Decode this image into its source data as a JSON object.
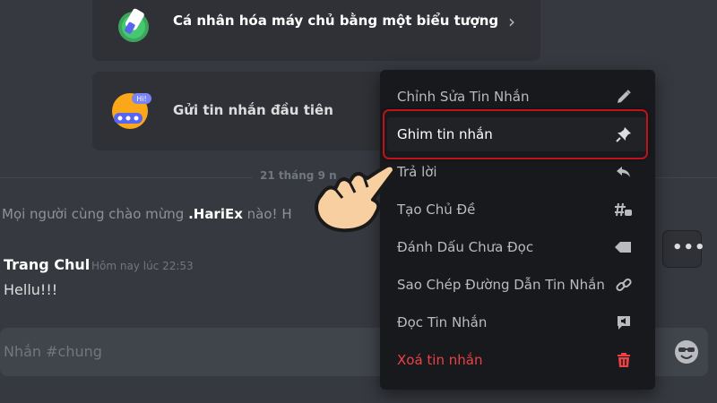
{
  "cards": {
    "customize_label": "Cá nhân hóa máy chủ bằng một biểu tượng",
    "first_message_label": "Gửi tin nhắn đầu tiên",
    "chevron": "›",
    "bubble_text": "Hi!"
  },
  "chat": {
    "date_divider": "21 tháng 9 n",
    "system_message": {
      "prefix": "Mọi người cùng chào mừng ",
      "username": ".HariEx",
      "suffix": " nào! H"
    },
    "message": {
      "author": "Trang Chul",
      "timestamp": "Hôm nay lúc 22:53",
      "text": "Hellu!!!"
    },
    "more_button": "•••"
  },
  "composer": {
    "placeholder": "Nhắn #chung"
  },
  "context_menu": {
    "items": [
      {
        "label": "Chỉnh Sửa Tin Nhắn",
        "icon": "pencil-icon"
      },
      {
        "label": "Ghim tin nhắn",
        "icon": "pin-icon",
        "highlighted": true
      },
      {
        "label": "Trả lời",
        "icon": "reply-icon"
      },
      {
        "label": "Tạo Chủ Đề",
        "icon": "thread-icon"
      },
      {
        "label": "Đánh Dấu Chưa Đọc",
        "icon": "tag-icon"
      },
      {
        "label": "Sao Chép Đường Dẫn Tin Nhắn",
        "icon": "link-icon"
      },
      {
        "label": "Đọc Tin Nhắn",
        "icon": "speaker-icon"
      },
      {
        "label": "Xoá tin nhắn",
        "icon": "trash-icon",
        "danger": true
      }
    ]
  },
  "colors": {
    "background": "#36393f",
    "menu_bg": "#18191c",
    "danger": "#ed4245",
    "highlight_border": "#c0121d"
  }
}
